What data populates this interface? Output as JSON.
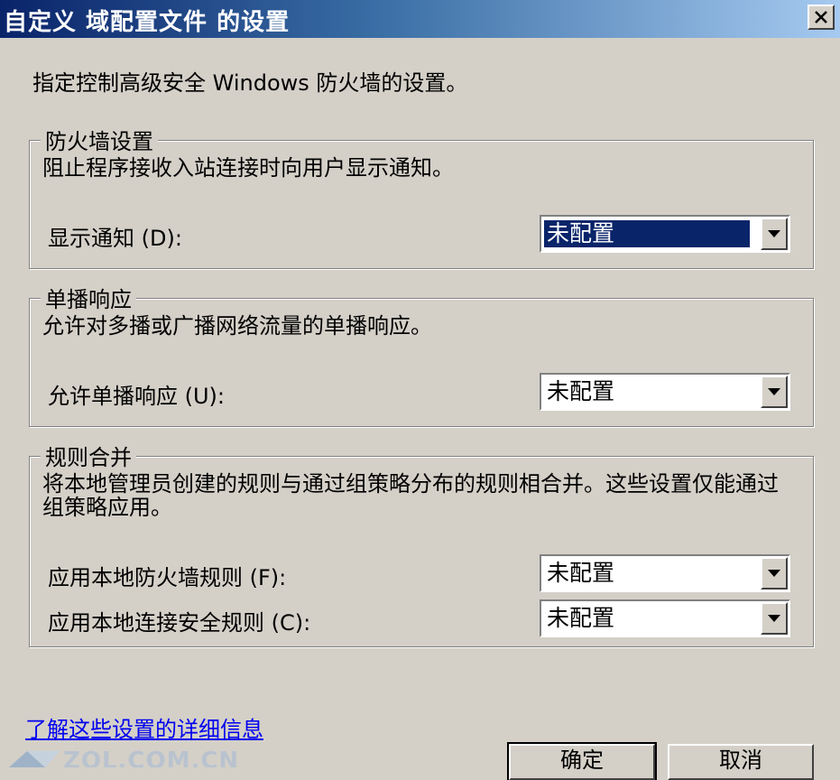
{
  "window": {
    "title": "自定义 域配置文件 的设置",
    "close_label": "×"
  },
  "intro_text": "指定控制高级安全 Windows 防火墙的设置。",
  "firewall_settings": {
    "legend": "防火墙设置",
    "description": "阻止程序接收入站连接时向用户显示通知。",
    "show_notifications": {
      "label": "显示通知 (D):",
      "value": "未配置"
    }
  },
  "unicast_response": {
    "legend": "单播响应",
    "description": "允许对多播或广播网络流量的单播响应。",
    "allow_unicast": {
      "label": "允许单播响应 (U):",
      "value": "未配置"
    }
  },
  "rule_merging": {
    "legend": "规则合并",
    "description": "将本地管理员创建的规则与通过组策略分布的规则相合并。这些设置仅能通过组策略应用。",
    "apply_firewall_rules": {
      "label": "应用本地防火墙规则 (F):",
      "value": "未配置"
    },
    "apply_connection_security_rules": {
      "label": "应用本地连接安全规则 (C):",
      "value": "未配置"
    }
  },
  "learn_more_link": "了解这些设置的详细信息",
  "watermark": "ZOL.COM.CN",
  "buttons": {
    "ok": "确定",
    "cancel": "取消"
  },
  "colors": {
    "titlebar_start": "#0a246a",
    "titlebar_end": "#a6caf0",
    "dialog_bg": "#d4d0c8",
    "selection": "#0a246a",
    "link": "#0000ee"
  }
}
